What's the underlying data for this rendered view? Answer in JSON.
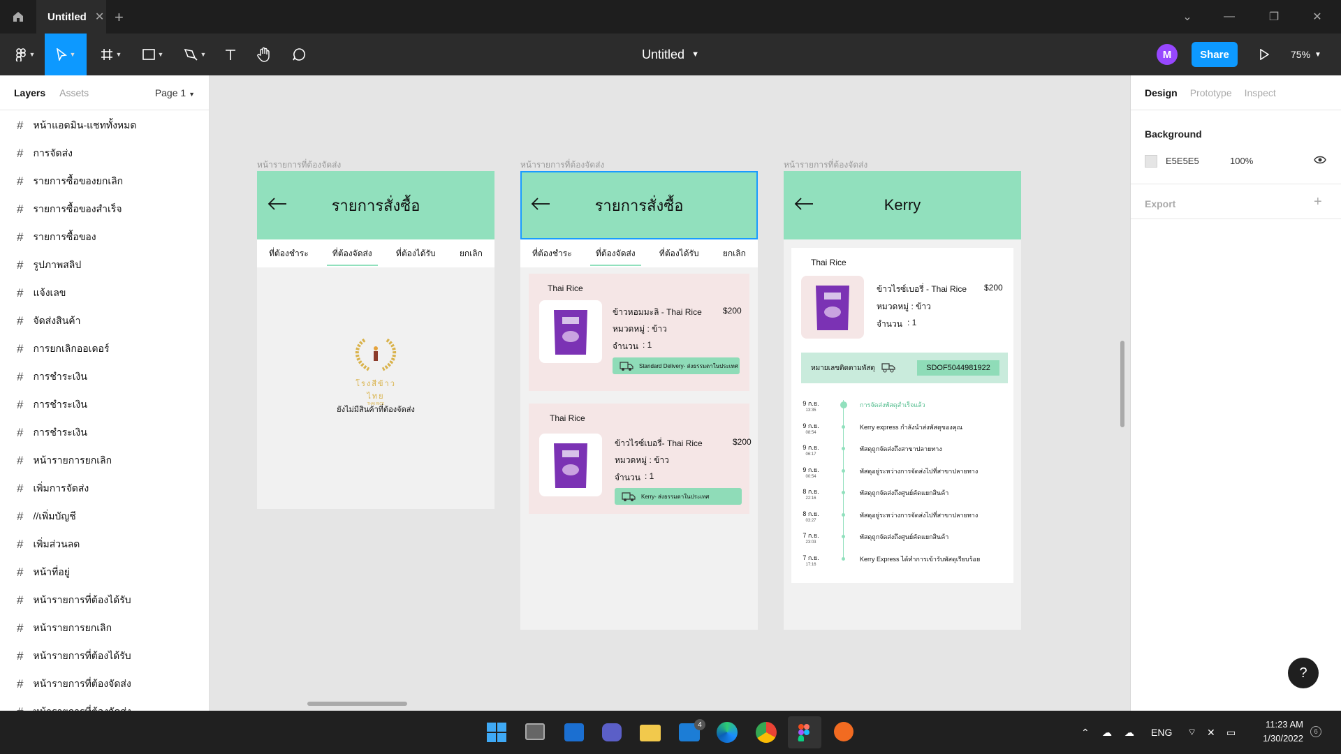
{
  "window": {
    "tab_title": "Untitled"
  },
  "toolbar": {
    "doc_title": "Untitled",
    "avatar": "M",
    "share_label": "Share",
    "zoom": "75%"
  },
  "left_panel": {
    "tab_layers": "Layers",
    "tab_assets": "Assets",
    "page": "Page 1",
    "layers": [
      "หน้าแอดมิน-แชททั้งหมด",
      "การจัดส่ง",
      "รายการซื้อของยกเลิก",
      "รายการซื้อของสำเร็จ",
      "รายการซื้อของ",
      "รูปภาพสลิป",
      "แจ้งเลข",
      "จัดส่งสินค้า",
      "การยกเลิกออเดอร์",
      "การชำระเงิน",
      "การชำระเงิน",
      "การชำระเงิน",
      "หน้ารายการยกเลิก",
      "เพิ่มการจัดส่ง",
      "//เพิ่มบัญชี",
      "เพิ่มส่วนลด",
      "หน้าที่อยู่",
      "หน้ารายการที่ต้องได้รับ",
      "หน้ารายการยกเลิก",
      "หน้ารายการที่ต้องได้รับ",
      "หน้ารายการที่ต้องจัดส่ง",
      "หน้ารายการที่ต้องจัดส่ง"
    ]
  },
  "right_panel": {
    "tabs": [
      "Design",
      "Prototype",
      "Inspect"
    ],
    "background_label": "Background",
    "bg_hex": "E5E5E5",
    "bg_opacity": "100%",
    "export_label": "Export"
  },
  "frames": {
    "label": "หน้ารายการที่ต้องจัดส่ง",
    "f1": {
      "title": "รายการสั่งซื้อ",
      "tabs": [
        "ที่ต้องชำระ",
        "ที่ต้องจัดส่ง",
        "ที่ต้องได้รับ",
        "ยกเลิก"
      ],
      "logo_text": "โรงสีข้าวไทย",
      "logo_sub": "THAI RICE",
      "empty": "ยังไม่มีสินค้าที่ต้องจัดส่ง"
    },
    "f2": {
      "title": "รายการสั่งซื้อ",
      "tabs": [
        "ที่ต้องชำระ",
        "ที่ต้องจัดส่ง",
        "ที่ต้องได้รับ",
        "ยกเลิก"
      ],
      "card1": {
        "shop": "Thai Rice",
        "name": "ข้าวหอมมะลิ - Thai Rice",
        "price": "$200",
        "cat": "หมวดหมู่  :  ข้าว",
        "qty_label": "จำนวน",
        "qty": ":   1",
        "ship": "Standard Delivery- ส่งธรรมดาในประเทศ"
      },
      "card2": {
        "shop": "Thai Rice",
        "name": "ข้าวไรซ์เบอรี่- Thai Rice",
        "price": "$200",
        "cat": "หมวดหมู่  :  ข้าว",
        "qty_label": "จำนวน",
        "qty": ":   1",
        "ship": "Kerry- ส่งธรรมดาในประเทศ"
      }
    },
    "f3": {
      "title": "Kerry",
      "shop": "Thai Rice",
      "name": "ข้าวไรซ์เบอรี่ - Thai Rice",
      "price": "$200",
      "cat": "หมวดหมู่  :  ข้าว",
      "qty_label": "จำนวน",
      "qty": ":   1",
      "tracking_label": "หมายเลขติดตามพัสดุ",
      "tracking_no": "SDOF5044981922",
      "timeline": [
        {
          "date": "9 ก.ย.",
          "time": "13:35",
          "text": "การจัดส่งพัสดุสำเร็จแล้ว",
          "active": true
        },
        {
          "date": "9 ก.ย.",
          "time": "08:54",
          "text": "Kerry express กำลังนำส่งพัสดุของคุณ",
          "active": false
        },
        {
          "date": "9 ก.ย.",
          "time": "06:17",
          "text": "พัสดุถูกจัดส่งถึงสาขาปลายทาง",
          "active": false
        },
        {
          "date": "9 ก.ย.",
          "time": "00:54",
          "text": "พัสดุอยู่ระหว่างการจัดส่งไปที่สาขาปลายทาง",
          "active": false
        },
        {
          "date": "8 ก.ย.",
          "time": "22:16",
          "text": "พัสดุถูกจัดส่งถึงศูนย์คัดแยกสินค้า",
          "active": false
        },
        {
          "date": "8 ก.ย.",
          "time": "03:27",
          "text": "พัสดุอยู่ระหว่างการจัดส่งไปที่สาขาปลายทาง",
          "active": false
        },
        {
          "date": "7 ก.ย.",
          "time": "23:03",
          "text": "พัสดุถูกจัดส่งถึงศูนย์คัดแยกสินค้า",
          "active": false
        },
        {
          "date": "7 ก.ย.",
          "time": "17:16",
          "text": "Kerry Express ได้ทำการเข้ารับพัสดุเรียบร้อย",
          "active": false
        }
      ]
    }
  },
  "help": "?",
  "taskbar": {
    "lang": "ENG",
    "time": "11:23 AM",
    "date": "1/30/2022",
    "badge_mail": "4",
    "notif_count": "6"
  },
  "colors": {
    "accent": "#0d99ff",
    "mint": "#91e0bd",
    "card": "#f5e6e6"
  }
}
